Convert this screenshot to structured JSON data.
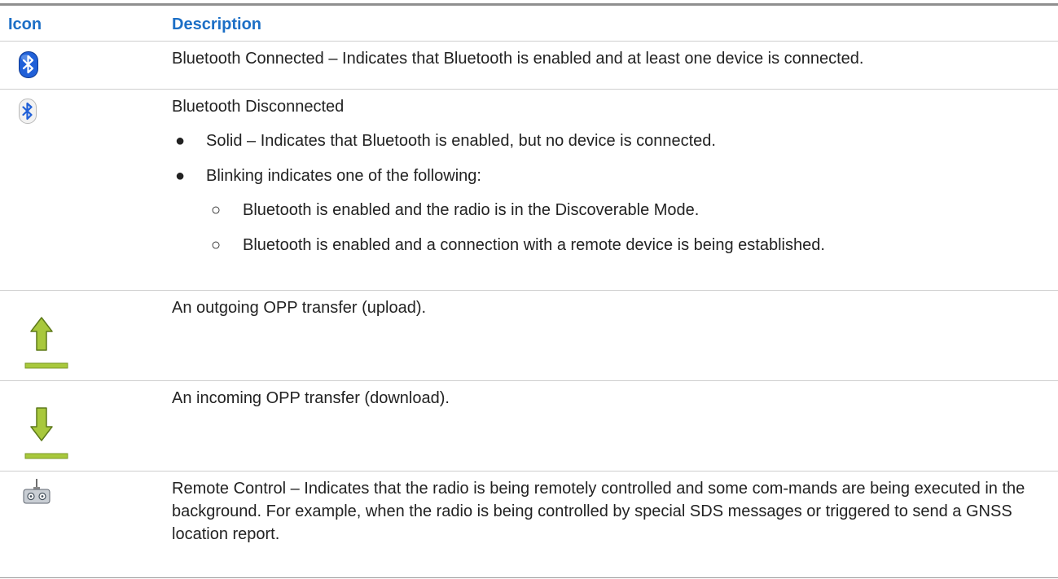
{
  "table": {
    "headers": {
      "icon": "Icon",
      "description": "Description"
    },
    "rows": [
      {
        "icon": "bluetooth-connected-icon",
        "text": "Bluetooth Connected – Indicates that Bluetooth is enabled and at least one device is connected."
      },
      {
        "icon": "bluetooth-disconnected-icon",
        "title": "Bluetooth Disconnected",
        "bullets": [
          "Solid – Indicates that Bluetooth is enabled, but no device is connected.",
          "Blinking indicates one of the following:"
        ],
        "subbullets": [
          "Bluetooth is enabled and the radio is in the Discoverable Mode.",
          "Bluetooth is enabled and a connection with a remote device is being established."
        ]
      },
      {
        "icon": "upload-arrow-icon",
        "text": "An outgoing OPP transfer (upload)."
      },
      {
        "icon": "download-arrow-icon",
        "text": "An incoming OPP transfer (download)."
      },
      {
        "icon": "remote-control-icon",
        "text": "Remote Control – Indicates that the radio is being remotely controlled and some com-mands are being executed in the background. For example, when the radio is being controlled by special SDS messages or triggered to send a GNSS location report."
      }
    ],
    "bullet_glyph": "●",
    "subbullet_glyph": "○"
  },
  "colors": {
    "header_text": "#1c6fc6",
    "body_text": "#222222",
    "rule": "#cfcfcf",
    "icon_blue": "#2060d8",
    "icon_green": "#a8c83c"
  }
}
